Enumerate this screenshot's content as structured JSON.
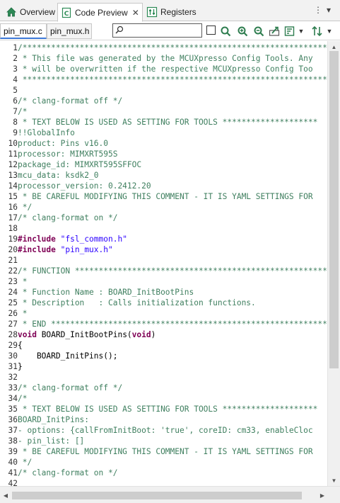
{
  "view_tabs": [
    {
      "label": "Overview",
      "icon": "home-icon"
    },
    {
      "label": "Code Preview",
      "icon": "c-file-icon",
      "close": "✕"
    },
    {
      "label": "Registers",
      "icon": "registers-icon"
    }
  ],
  "view_menu": {
    "minimize": "⋮",
    "menu": "▾"
  },
  "file_tabs": [
    {
      "label": "pin_mux.c",
      "active": true
    },
    {
      "label": "pin_mux.h",
      "active": false
    }
  ],
  "search": {
    "value": "",
    "placeholder": ""
  },
  "toolbar_icons": [
    "regex-checkbox",
    "search-icon",
    "zoom-in-icon",
    "zoom-out-icon",
    "export-icon",
    "filter-icon",
    "sort-icon"
  ],
  "colors": {
    "comment": "#3f7f5f",
    "keyword": "#7f0055",
    "string": "#2a00ff",
    "accent": "#3c78d8"
  },
  "code_lines": [
    {
      "n": "1",
      "parts": [
        [
          "c",
          "/***********************************************************************"
        ]
      ]
    },
    {
      "n": "2",
      "parts": [
        [
          "c",
          " * This file was generated by the MCUXpresso Config Tools. Any"
        ]
      ]
    },
    {
      "n": "3",
      "parts": [
        [
          "c",
          " * will be overwritten if the respective MCUXpresso Config Too"
        ]
      ]
    },
    {
      "n": "4",
      "parts": [
        [
          "c",
          " ***********************************************************************"
        ]
      ]
    },
    {
      "n": "5",
      "parts": []
    },
    {
      "n": "6",
      "parts": [
        [
          "c",
          "/* clang-format off */"
        ]
      ]
    },
    {
      "n": "7",
      "parts": [
        [
          "c",
          "/*"
        ]
      ]
    },
    {
      "n": "8",
      "parts": [
        [
          "c",
          " * TEXT BELOW IS USED AS SETTING FOR TOOLS ********************"
        ]
      ]
    },
    {
      "n": "9",
      "parts": [
        [
          "c",
          "!!GlobalInfo"
        ]
      ]
    },
    {
      "n": "10",
      "parts": [
        [
          "c",
          "product: Pins v16.0"
        ]
      ]
    },
    {
      "n": "11",
      "parts": [
        [
          "c",
          "processor: MIMXRT595S"
        ]
      ]
    },
    {
      "n": "12",
      "parts": [
        [
          "c",
          "package_id: MIMXRT595SFFOC"
        ]
      ]
    },
    {
      "n": "13",
      "parts": [
        [
          "c",
          "mcu_data: ksdk2_0"
        ]
      ]
    },
    {
      "n": "14",
      "parts": [
        [
          "c",
          "processor_version: 0.2412.20"
        ]
      ]
    },
    {
      "n": "15",
      "parts": [
        [
          "c",
          " * BE CAREFUL MODIFYING THIS COMMENT - IT IS YAML SETTINGS FOR"
        ]
      ]
    },
    {
      "n": "16",
      "parts": [
        [
          "c",
          " */"
        ]
      ]
    },
    {
      "n": "17",
      "parts": [
        [
          "c",
          "/* clang-format on */"
        ]
      ]
    },
    {
      "n": "18",
      "parts": []
    },
    {
      "n": "19",
      "parts": [
        [
          "k",
          "#include"
        ],
        [
          "p",
          " "
        ],
        [
          "s",
          "\"fsl_common.h\""
        ]
      ]
    },
    {
      "n": "20",
      "parts": [
        [
          "k",
          "#include"
        ],
        [
          "p",
          " "
        ],
        [
          "s",
          "\"pin_mux.h\""
        ]
      ]
    },
    {
      "n": "21",
      "parts": []
    },
    {
      "n": "22",
      "parts": [
        [
          "c",
          "/* FUNCTION ***********************************************************"
        ]
      ]
    },
    {
      "n": "23",
      "parts": [
        [
          "c",
          " *"
        ]
      ]
    },
    {
      "n": "24",
      "parts": [
        [
          "c",
          " * Function Name : BOARD_InitBootPins"
        ]
      ]
    },
    {
      "n": "25",
      "parts": [
        [
          "c",
          " * Description   : Calls initialization functions."
        ]
      ]
    },
    {
      "n": "26",
      "parts": [
        [
          "c",
          " *"
        ]
      ]
    },
    {
      "n": "27",
      "parts": [
        [
          "c",
          " * END ****************************************************************"
        ]
      ]
    },
    {
      "n": "28",
      "parts": [
        [
          "k",
          "void"
        ],
        [
          "p",
          " BOARD_InitBootPins("
        ],
        [
          "k",
          "void"
        ],
        [
          "p",
          ")"
        ]
      ]
    },
    {
      "n": "29",
      "parts": [
        [
          "p",
          "{"
        ]
      ]
    },
    {
      "n": "30",
      "parts": [
        [
          "p",
          "    BOARD_InitPins();"
        ]
      ]
    },
    {
      "n": "31",
      "parts": [
        [
          "p",
          "}"
        ]
      ]
    },
    {
      "n": "32",
      "parts": []
    },
    {
      "n": "33",
      "parts": [
        [
          "c",
          "/* clang-format off */"
        ]
      ]
    },
    {
      "n": "34",
      "parts": [
        [
          "c",
          "/*"
        ]
      ]
    },
    {
      "n": "35",
      "parts": [
        [
          "c",
          " * TEXT BELOW IS USED AS SETTING FOR TOOLS ********************"
        ]
      ]
    },
    {
      "n": "36",
      "parts": [
        [
          "c",
          "BOARD_InitPins:"
        ]
      ]
    },
    {
      "n": "37",
      "parts": [
        [
          "c",
          "- options: {callFromInitBoot: 'true', coreID: cm33, enableCloc"
        ]
      ]
    },
    {
      "n": "38",
      "parts": [
        [
          "c",
          "- pin_list: []"
        ]
      ]
    },
    {
      "n": "39",
      "parts": [
        [
          "c",
          " * BE CAREFUL MODIFYING THIS COMMENT - IT IS YAML SETTINGS FOR"
        ]
      ]
    },
    {
      "n": "40",
      "parts": [
        [
          "c",
          " */"
        ]
      ]
    },
    {
      "n": "41",
      "parts": [
        [
          "c",
          "/* clang-format on */"
        ]
      ]
    },
    {
      "n": "42",
      "parts": []
    }
  ]
}
